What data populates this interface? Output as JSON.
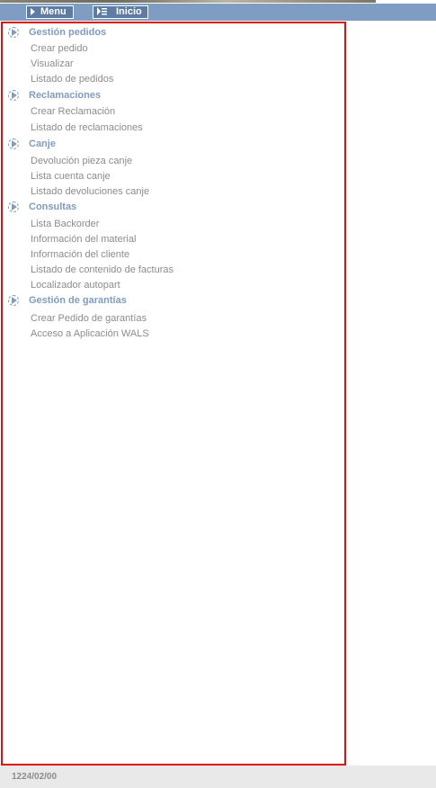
{
  "toolbar": {
    "menu_label": "Menu",
    "inicio_label": "Inicio"
  },
  "sections": [
    {
      "title": "Gestión pedidos",
      "icon": "play-circle-icon",
      "items": [
        "Crear pedido",
        "Visualizar",
        "Listado de pedidos"
      ]
    },
    {
      "title": "Reclamaciones",
      "icon": "play-circle-icon",
      "items": [
        "Crear Reclamación",
        "Listado de reclamaciones"
      ]
    },
    {
      "title": "Canje",
      "icon": "play-circle-icon",
      "items": [
        "Devolución pieza canje",
        "Lista cuenta canje",
        "Listado devoluciones canje"
      ]
    },
    {
      "title": "Consultas",
      "icon": "play-circle-icon",
      "items": [
        "Lista Backorder",
        "Información del material",
        "Información del cliente",
        "Listado de contenido de facturas",
        "Localizador autopart"
      ]
    },
    {
      "title": "Gestión de garantías",
      "icon": "play-circle-icon",
      "items": [
        "Crear Pedido de garantías",
        "Acceso a Aplicación WALS"
      ]
    }
  ],
  "footer": {
    "code": "1224/02/00"
  },
  "colors": {
    "toolbar_bg": "#7f9cc2",
    "section_title": "#7f9cc2",
    "item_text": "#8c8c8c",
    "panel_border": "#e01010",
    "footer_bg": "#e9e9e9"
  }
}
